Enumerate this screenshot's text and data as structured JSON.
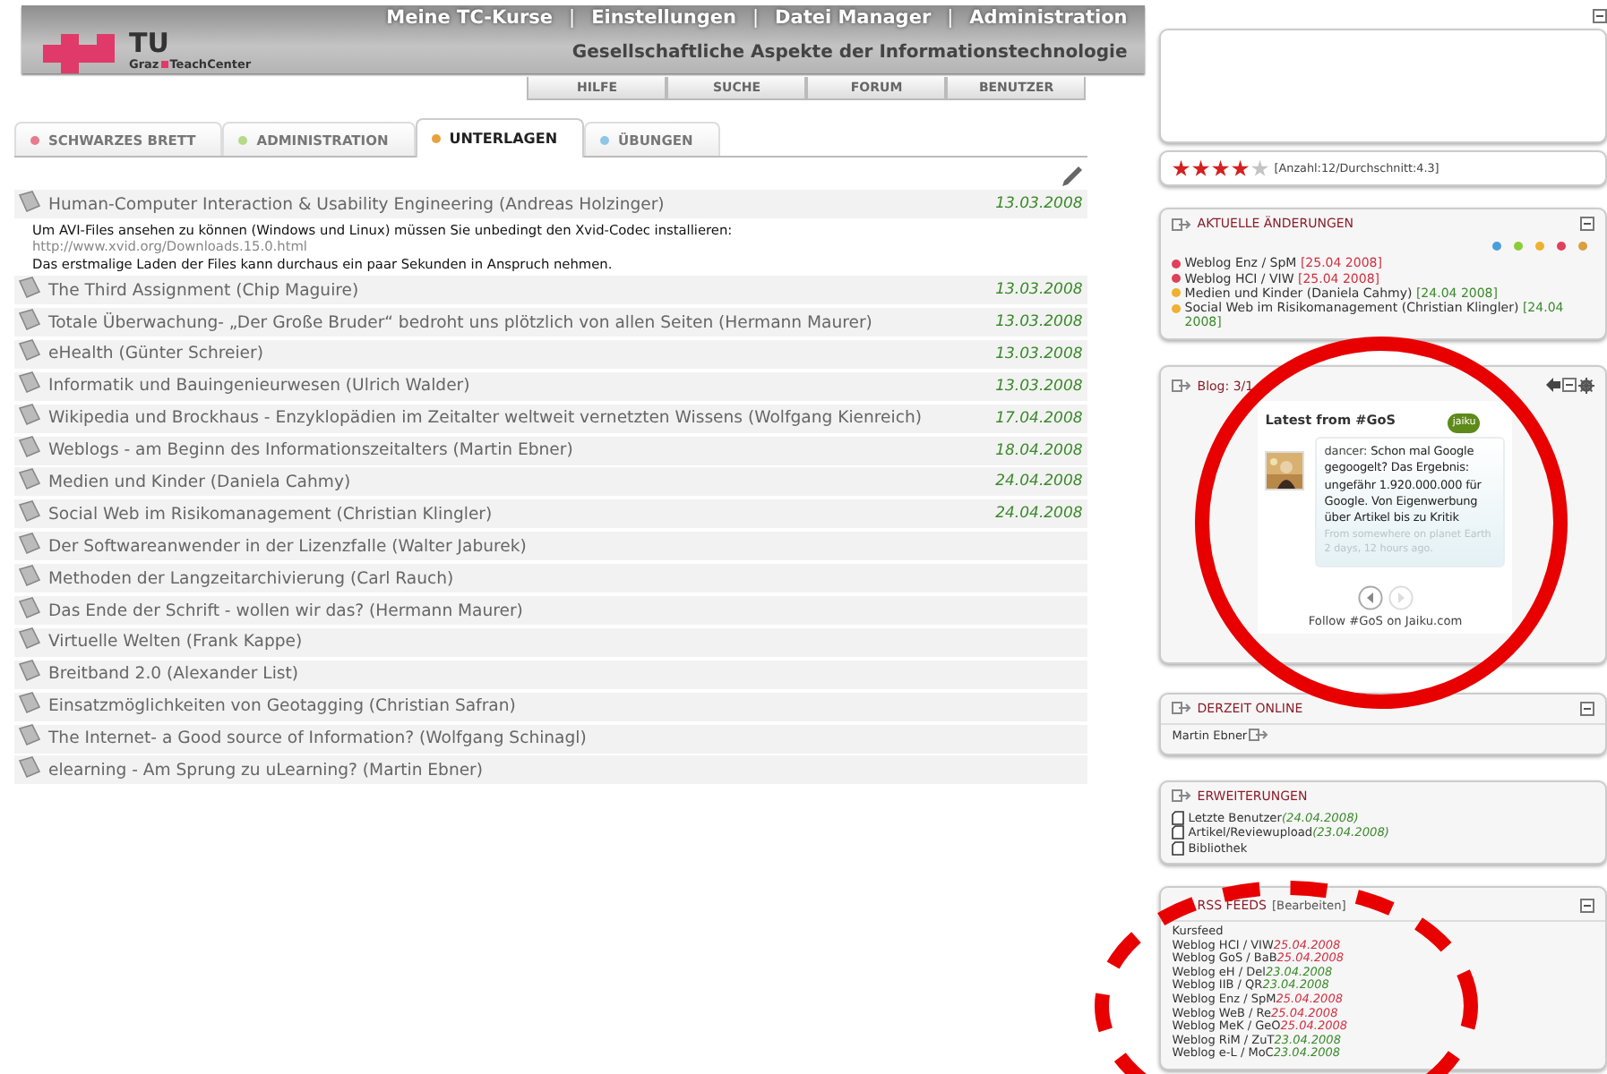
{
  "header": {
    "top_links": [
      {
        "kind": "link",
        "text": "Meine TC-Kurse"
      },
      {
        "kind": "separator",
        "text": "|"
      },
      {
        "kind": "link",
        "text": "Einstellungen"
      },
      {
        "kind": "separator",
        "text": "|"
      },
      {
        "kind": "link",
        "text": "Datei Manager"
      },
      {
        "kind": "separator",
        "text": "|"
      },
      {
        "kind": "link",
        "text": "Administration"
      }
    ],
    "logo": {
      "mark": "TU",
      "city": "Graz",
      "name": "TeachCenter"
    },
    "course_title": "Gesellschaftliche Aspekte der Informationstechnologie",
    "nav_buttons": [
      "HILFE",
      "SUCHE",
      "FORUM",
      "BENUTZER"
    ]
  },
  "tabs": [
    {
      "label": "SCHWARZES BRETT",
      "selected": false,
      "color": "#e87a8e"
    },
    {
      "label": "ADMINISTRATION",
      "selected": false,
      "color": "#b6d98a"
    },
    {
      "label": "UNTERLAGEN",
      "selected": true,
      "color": "#e8a23a"
    },
    {
      "label": "ÜBUNGEN",
      "selected": false,
      "color": "#8ec6e6"
    }
  ],
  "documents": [
    {
      "title": "Human-Computer Interaction & Usability Engineering (Andreas Holzinger)",
      "date": "13.03.2008",
      "description": [
        {
          "kind": "text",
          "text": "Um AVI-Files ansehen zu können (Windows und Linux) müssen Sie unbedingt den Xvid-Codec installieren:"
        },
        {
          "kind": "link",
          "text": "http://www.xvid.org/Downloads.15.0.html"
        },
        {
          "kind": "text",
          "text": "Das erstmalige Laden der Files kann durchaus ein paar Sekunden in Anspruch nehmen."
        }
      ]
    },
    {
      "title": "The Third Assignment (Chip Maguire)",
      "date": "13.03.2008"
    },
    {
      "title": "Totale Überwachung- „Der Große Bruder“ bedroht uns plötzlich von allen Seiten (Hermann Maurer)",
      "date": "13.03.2008"
    },
    {
      "title": "eHealth (Günter Schreier)",
      "date": "13.03.2008"
    },
    {
      "title": "Informatik und Bauingenieurwesen (Ulrich Walder)",
      "date": "13.03.2008"
    },
    {
      "title": "Wikipedia und Brockhaus - Enzyklopädien im Zeitalter weltweit vernetzten Wissens (Wolfgang Kienreich)",
      "date": "17.04.2008"
    },
    {
      "title": "Weblogs - am Beginn des Informationszeitalters (Martin Ebner)",
      "date": "18.04.2008"
    },
    {
      "title": "Medien und Kinder (Daniela Cahmy)",
      "date": "24.04.2008"
    },
    {
      "title": "Social Web im Risikomanagement (Christian Klingler)",
      "date": "24.04.2008"
    },
    {
      "title": "Der Softwareanwender in der Lizenzfalle (Walter Jaburek)"
    },
    {
      "title": "Methoden der Langzeitarchivierung (Carl Rauch)"
    },
    {
      "title": "Das Ende der Schrift - wollen wir das? (Hermann Maurer)"
    },
    {
      "title": "Virtuelle Welten (Frank Kappe)"
    },
    {
      "title": "Breitband 2.0 (Alexander List)"
    },
    {
      "title": "Einsatzmöglichkeiten von Geotagging (Christian Safran)"
    },
    {
      "title": "The Internet- a Good source of Information? (Wolfgang Schinagl)"
    },
    {
      "title": "elearning - Am Sprung zu uLearning? (Martin Ebner)"
    }
  ],
  "rating": {
    "stars": 4,
    "text": "[Anzahl:12/Durchschnitt:4.3]"
  },
  "changes": {
    "title": "AKTUELLE ÄNDERUNGEN",
    "legend": [
      {
        "color": "#4a9ee0"
      },
      {
        "color": "#8ccc3a"
      },
      {
        "color": "#f0b030"
      },
      {
        "color": "#e0405a"
      },
      {
        "color": "#d8a040"
      }
    ],
    "items": [
      {
        "text": "Weblog Enz / SpM",
        "date": "[25.04 2008]",
        "color": "#e0405a",
        "recent": true
      },
      {
        "text": "Weblog HCI / VIW",
        "date": "[25.04 2008]",
        "color": "#e0405a",
        "recent": true
      },
      {
        "text": "Medien und Kinder (Daniela Cahmy)",
        "date": "[24.04 2008]",
        "color": "#f0b030",
        "recent": false
      },
      {
        "text": "Social Web im Risikomanagement (Christian Klingler)",
        "date": "[24.04 2008]",
        "color": "#f0b030",
        "recent": false
      }
    ]
  },
  "blog": {
    "title": "Blog: 3/1",
    "widget": {
      "heading": "Latest from #GoS",
      "badge": "jaiku",
      "author": "dancer:",
      "message": "Schon mal Google gegoogelt? Das Ergebnis: ungefähr 1.920.000.000 für Google. Von Eigenwerbung über Artikel bis zu Kritik",
      "meta": "From somewhere on planet Earth 2 days, 12 hours ago.",
      "footer": "Follow #GoS on Jaiku.com"
    }
  },
  "online": {
    "title": "DERZEIT ONLINE",
    "users": [
      "Martin Ebner"
    ]
  },
  "extensions": {
    "title": "ERWEITERUNGEN",
    "items": [
      {
        "label": "Letzte Benutzer",
        "date": "(24.04.2008)"
      },
      {
        "label": "Artikel/Reviewupload",
        "date": "(23.04.2008)"
      },
      {
        "label": "Bibliothek"
      }
    ]
  },
  "rss": {
    "title": "RSS FEEDS",
    "edit": "[Bearbeiten]",
    "items": [
      {
        "label": "Kursfeed"
      },
      {
        "label": "Weblog HCI / VIW",
        "date": "25.04.2008",
        "recent": true
      },
      {
        "label": "Weblog GoS / BaB",
        "date": "25.04.2008",
        "recent": true
      },
      {
        "label": "Weblog eH / Del",
        "date": "23.04.2008",
        "recent": false
      },
      {
        "label": "Weblog IIB / QR",
        "date": "23.04.2008",
        "recent": false
      },
      {
        "label": "Weblog Enz / SpM",
        "date": "25.04.2008",
        "recent": true
      },
      {
        "label": "Weblog WeB / Re",
        "date": "25.04.2008",
        "recent": true
      },
      {
        "label": "Weblog MeK / GeO",
        "date": "25.04.2008",
        "recent": true
      },
      {
        "label": "Weblog RiM / ZuT",
        "date": "23.04.2008",
        "recent": false
      },
      {
        "label": "Weblog e-L / MoC",
        "date": "23.04.2008",
        "recent": false
      }
    ]
  },
  "annotations": [
    {
      "kind": "solid"
    },
    {
      "kind": "dashed"
    }
  ]
}
